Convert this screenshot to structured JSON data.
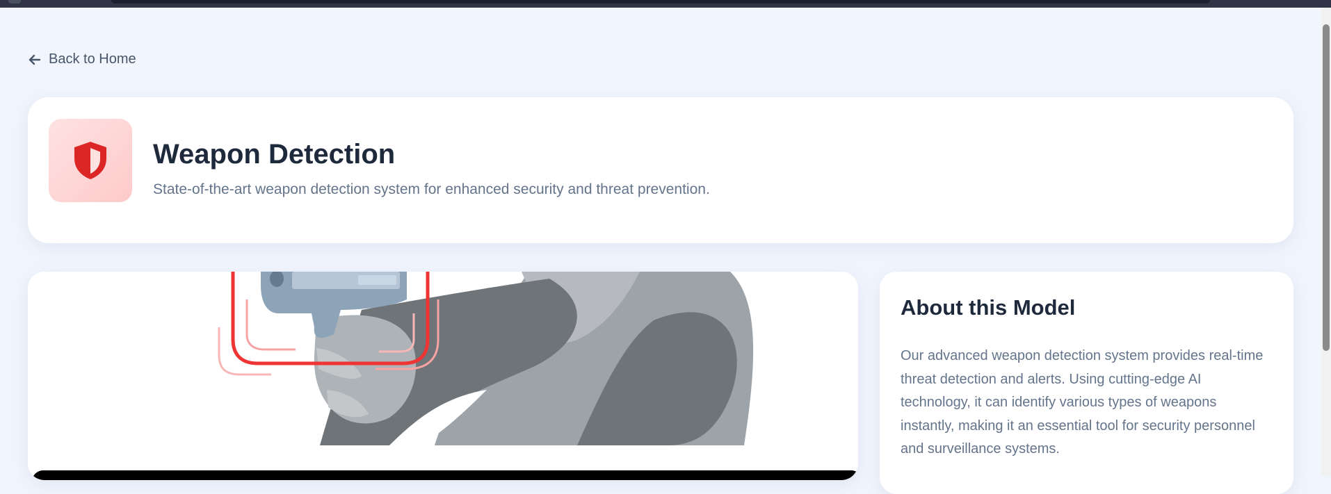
{
  "nav": {
    "back_label": "Back to Home"
  },
  "header": {
    "title": "Weapon Detection",
    "subtitle": "State-of-the-art weapon detection system for enhanced security and threat prevention.",
    "icon": "shield-icon"
  },
  "about": {
    "title": "About this Model",
    "description": "Our advanced weapon detection system provides real-time threat detection and alerts. Using cutting-edge AI technology, it can identify various types of weapons instantly, making it an essential tool for security personnel and surveillance systems."
  },
  "colors": {
    "accent": "#dc2626",
    "background": "#f1f5fd",
    "title": "#1e293b",
    "muted": "#64748b"
  }
}
